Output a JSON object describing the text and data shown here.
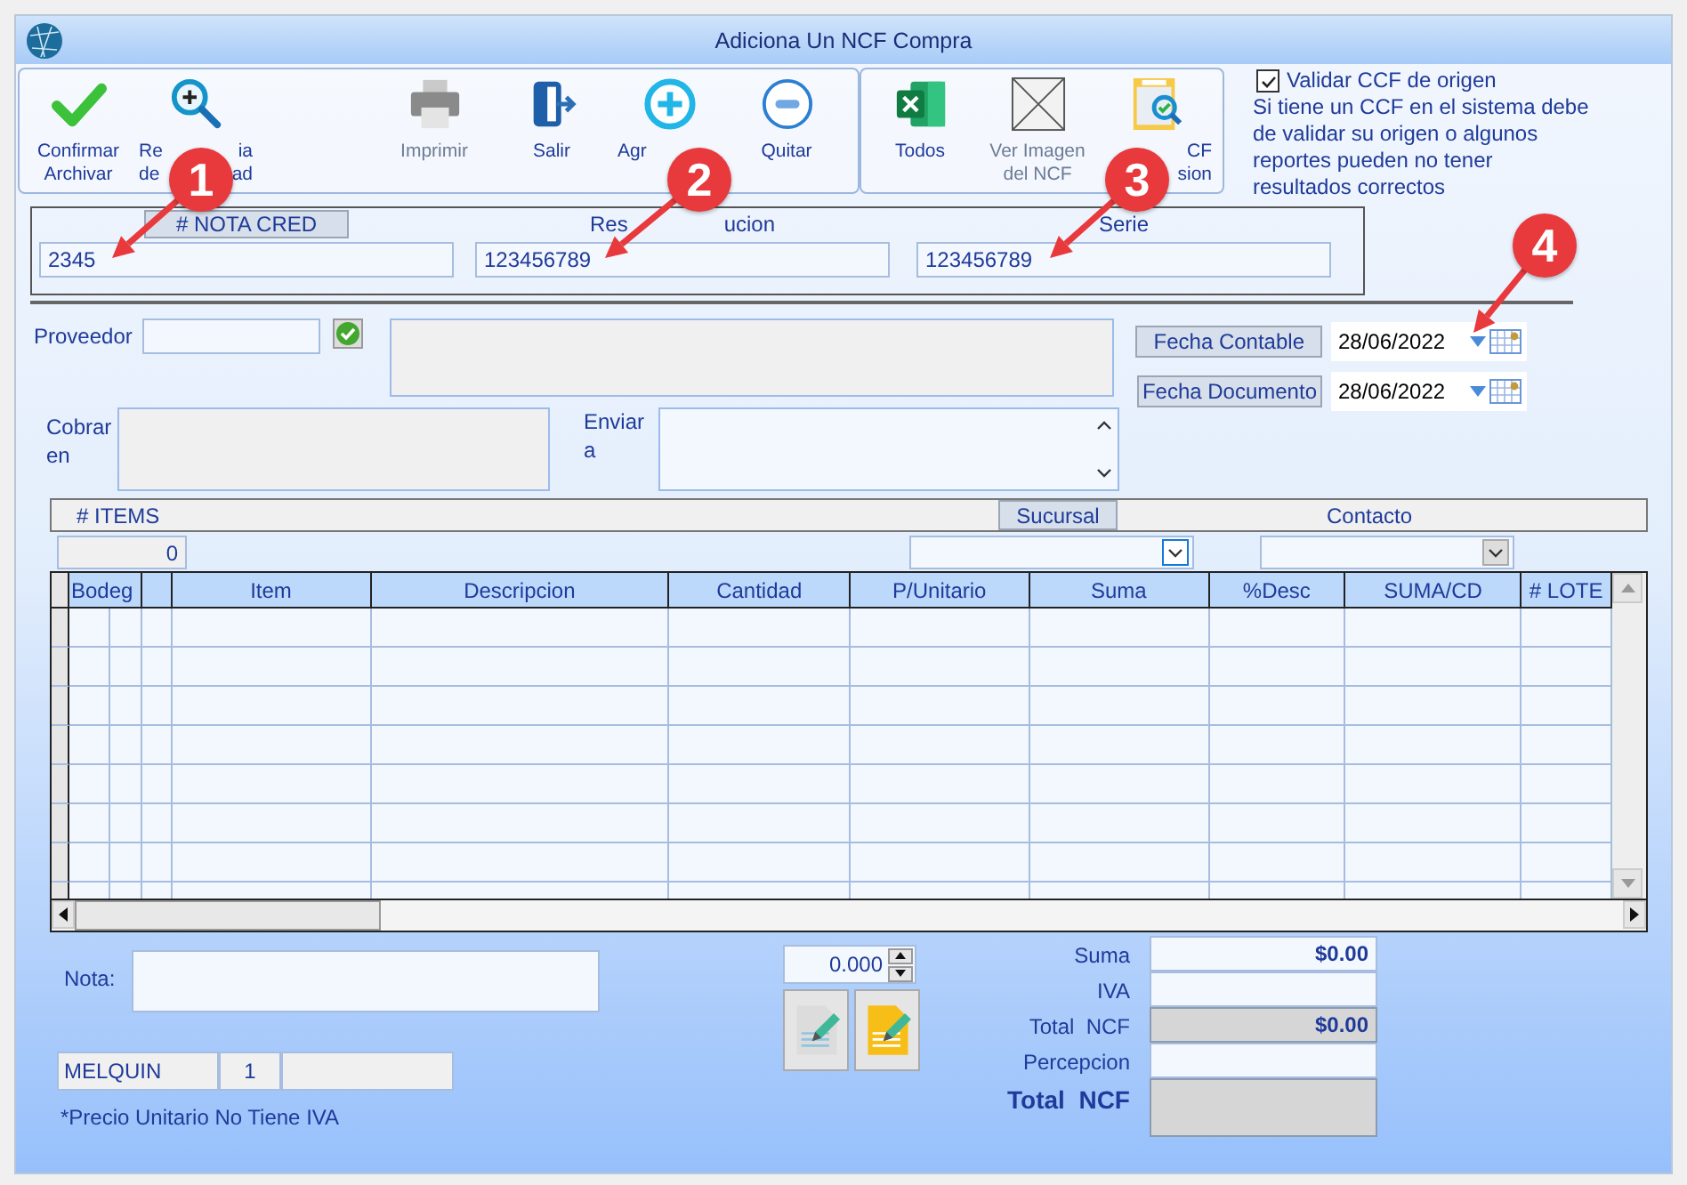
{
  "window": {
    "title": "Adiciona Un NCF Compra"
  },
  "toolbar_groups": [
    {
      "buttons": [
        {
          "kind": "check",
          "disabled": false,
          "lines": [
            {
              "center": "Confirmar"
            },
            {
              "center": "Archivar"
            }
          ]
        },
        {
          "kind": "zoom",
          "disabled": false,
          "lines": [
            {
              "left": "Re",
              "right": "ia"
            },
            {
              "left": "de",
              "right": "ad"
            }
          ]
        },
        {
          "kind": "printer",
          "disabled": true,
          "lines": [
            {
              "center": "Imprimir"
            }
          ]
        },
        {
          "kind": "exit",
          "disabled": false,
          "lines": [
            {
              "center": "Salir"
            }
          ]
        },
        {
          "kind": "add",
          "disabled": false,
          "lines": [
            {
              "left": "Agr"
            }
          ]
        },
        {
          "kind": "remove",
          "disabled": false,
          "lines": [
            {
              "center": "Quitar"
            }
          ]
        }
      ]
    },
    {
      "buttons": [
        {
          "kind": "excel",
          "disabled": false,
          "lines": [
            {
              "center": "Todos"
            }
          ]
        },
        {
          "kind": "image",
          "disabled": true,
          "lines": [
            {
              "center": "Ver Imagen"
            },
            {
              "center": "del NCF"
            }
          ]
        },
        {
          "kind": "ccf",
          "disabled": false,
          "lines": [
            {
              "right": "CF"
            },
            {
              "right": "sion"
            }
          ]
        }
      ]
    }
  ],
  "validation": {
    "label": "Validar CCF de origen",
    "checked": true,
    "note": "Si tiene un CCF en el sistema debe de validar su origen o algunos reportes pueden no tener resultados correctos"
  },
  "document_fields": [
    {
      "label": {
        "center": "# NOTA CRED"
      },
      "boxed": true,
      "value": "2345"
    },
    {
      "label": {
        "left": "Res",
        "right": "ucion"
      },
      "boxed": false,
      "value": "123456789"
    },
    {
      "label": {
        "center": "Serie"
      },
      "boxed": false,
      "value": "123456789"
    }
  ],
  "proveedor": {
    "label": "Proveedor"
  },
  "cobrar": {
    "label": "Cobrar en"
  },
  "enviar": {
    "label": "Enviar a"
  },
  "dates": [
    {
      "label": "Fecha Contable",
      "value": "28/06/2022"
    },
    {
      "label": "Fecha Documento",
      "value": "28/06/2022"
    }
  ],
  "items_bar": {
    "items_label": "# ITEMS",
    "count": "0",
    "sucursal_label": "Sucursal",
    "contacto_label": "Contacto",
    "sucursal_disabled": false,
    "contacto_disabled": true
  },
  "table": {
    "columns": [
      "Bodeg",
      "Item",
      "Descripcion",
      "Cantidad",
      "P/Unitario",
      "Suma",
      "%Desc",
      "SUMA/CD",
      "# LOTE"
    ]
  },
  "nota": {
    "label": "Nota:"
  },
  "spinner": {
    "value": "0.000"
  },
  "user_cells": [
    "MELQUIN",
    "1"
  ],
  "footnote": "*Precio Unitario No Tiene IVA",
  "totals": [
    {
      "label": "Suma",
      "value": "$0.00",
      "shaded": false,
      "emphasis": false
    },
    {
      "label": "IVA",
      "shaded": false,
      "emphasis": false
    },
    {
      "label": "Total  NCF",
      "value": "$0.00",
      "shaded": true,
      "emphasis": false
    },
    {
      "label": "Percepcion",
      "shaded": false,
      "emphasis": false
    },
    {
      "label": "Total  NCF",
      "shaded": true,
      "emphasis": true
    }
  ],
  "callouts": [
    {
      "number": "1"
    },
    {
      "number": "2"
    },
    {
      "number": "3"
    },
    {
      "number": "4"
    }
  ]
}
